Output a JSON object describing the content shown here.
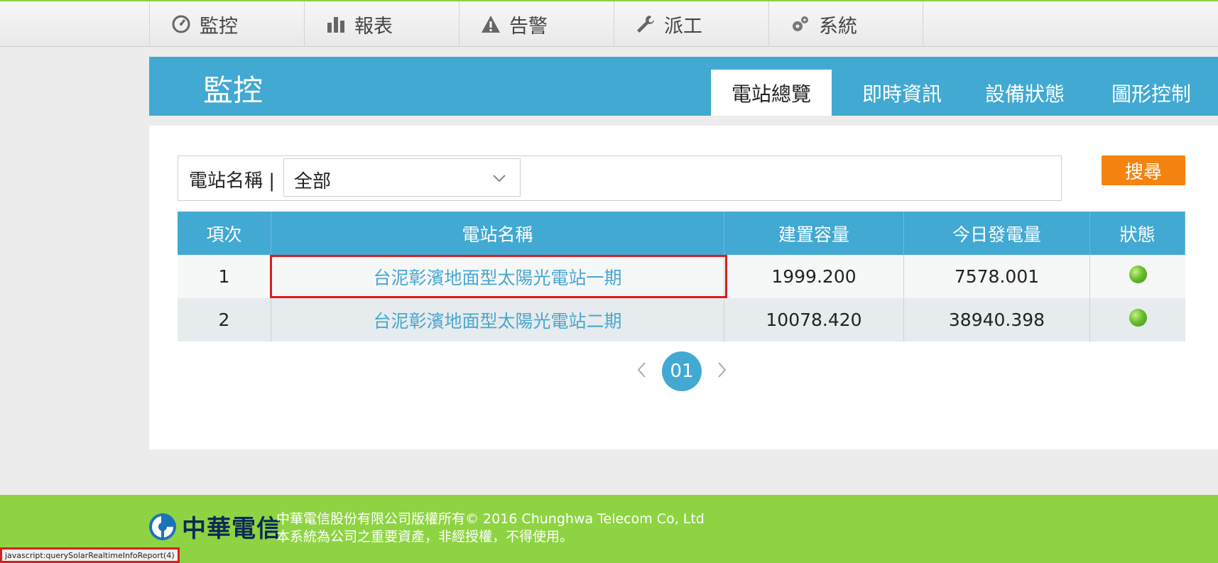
{
  "nav": {
    "items": [
      {
        "label": "監控",
        "icon": "gauge-icon"
      },
      {
        "label": "報表",
        "icon": "bar-chart-icon"
      },
      {
        "label": "告警",
        "icon": "warning-icon"
      },
      {
        "label": "派工",
        "icon": "wrench-icon"
      },
      {
        "label": "系統",
        "icon": "gears-icon"
      }
    ]
  },
  "header": {
    "title": "監控",
    "tabs": [
      {
        "label": "電站總覽",
        "active": true
      },
      {
        "label": "即時資訊",
        "active": false
      },
      {
        "label": "設備狀態",
        "active": false
      },
      {
        "label": "圖形控制",
        "active": false
      }
    ]
  },
  "search": {
    "label": "電站名稱 |",
    "selected": "全部",
    "button": "搜尋"
  },
  "table": {
    "columns": [
      "項次",
      "電站名稱",
      "建置容量",
      "今日發電量",
      "狀態"
    ],
    "rows": [
      {
        "index": "1",
        "name": "台泥彰濱地面型太陽光電站一期",
        "capacity": "1999.200",
        "today": "7578.001",
        "status": "online"
      },
      {
        "index": "2",
        "name": "台泥彰濱地面型太陽光電站二期",
        "capacity": "10078.420",
        "today": "38940.398",
        "status": "online"
      }
    ]
  },
  "pagination": {
    "current": "01"
  },
  "footer": {
    "logo_text": "中華電信",
    "line1": "中華電信股份有限公司版權所有© 2016 Chunghwa Telecom Co, Ltd",
    "line2": "本系統為公司之重要資產，非經授權，不得使用。"
  },
  "statusbar": {
    "text": "javascript:querySolarRealtimeInfoReport(4)"
  },
  "colors": {
    "accent": "#41a9d2",
    "search_button": "#f5830f",
    "footer": "#8ed442",
    "highlight": "#d81e1e",
    "status_ok": "#6bbf2a"
  }
}
